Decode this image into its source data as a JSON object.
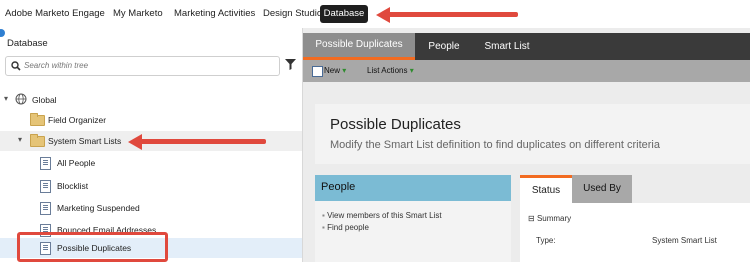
{
  "topnav": {
    "items": [
      "Adobe Marketo Engage",
      "My Marketo",
      "Marketing Activities",
      "Design Studio",
      "Database"
    ],
    "active": "Database"
  },
  "tree": {
    "title": "Database",
    "search_placeholder": "Search within tree",
    "nodes": [
      {
        "label": "Global"
      },
      {
        "label": "Field Organizer"
      },
      {
        "label": "System Smart Lists"
      },
      {
        "label": "All People"
      },
      {
        "label": "Blocklist"
      },
      {
        "label": "Marketing Suspended"
      },
      {
        "label": "Bounced Email Addresses"
      },
      {
        "label": "Possible Duplicates"
      }
    ]
  },
  "main": {
    "tabs": [
      "Possible Duplicates",
      "People",
      "Smart List"
    ],
    "toolbar": {
      "new_label": "New",
      "list_actions_label": "List Actions"
    },
    "header": {
      "title": "Possible Duplicates",
      "subtitle": "Modify the Smart List definition to find duplicates on different criteria"
    },
    "people_panel": {
      "title": "People",
      "links": [
        "View members of this Smart List",
        "Find people"
      ]
    },
    "status_panel": {
      "tabs": [
        "Status",
        "Used By"
      ],
      "summary_label": "Summary",
      "type_label": "Type:",
      "type_value": "System Smart List"
    }
  },
  "colors": {
    "annotation": "#e0493d",
    "active_tab_accent": "#f26b21",
    "people_header": "#7bbbd4"
  }
}
